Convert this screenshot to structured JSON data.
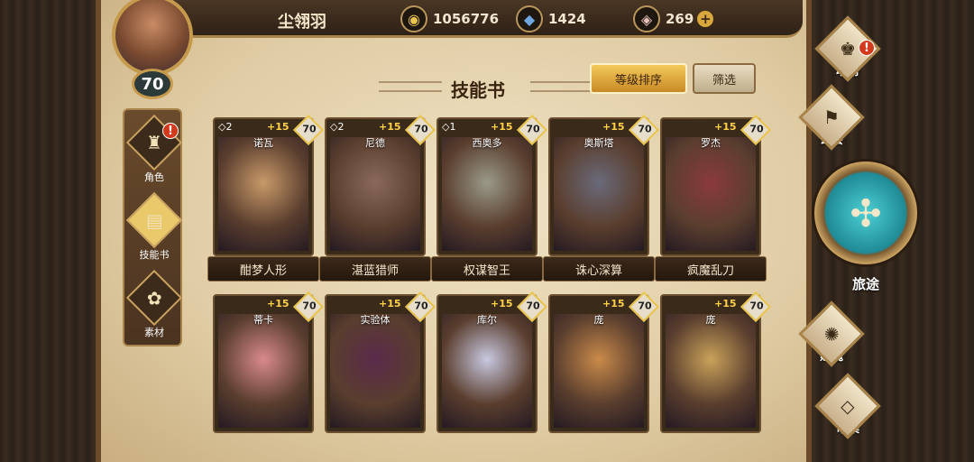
{
  "header": {
    "player_name": "尘翎羽",
    "gold": "1056776",
    "crystal": "1424",
    "gem": "269",
    "plus": "+"
  },
  "player": {
    "level": "70"
  },
  "sidenav": [
    {
      "label": "角色",
      "icon": "helmet-icon",
      "glyph": "♜",
      "alert": "!"
    },
    {
      "label": "技能书",
      "icon": "skillbook-icon",
      "glyph": "▤"
    },
    {
      "label": "素材",
      "icon": "material-icon",
      "glyph": "✿"
    }
  ],
  "section": {
    "title": "技能书",
    "sort_label": "等级排序",
    "filter_label": "筛选"
  },
  "cards": [
    {
      "name": "诺瓦",
      "stars": "◇2",
      "plus": "+15",
      "level": "70",
      "skill": "酣梦人形"
    },
    {
      "name": "尼德",
      "stars": "◇2",
      "plus": "+15",
      "level": "70",
      "skill": "湛蓝猎师"
    },
    {
      "name": "西奥多",
      "stars": "◇1",
      "plus": "+15",
      "level": "70",
      "skill": "权谋智王"
    },
    {
      "name": "奥斯塔",
      "stars": "",
      "plus": "+15",
      "level": "70",
      "skill": "诛心深算"
    },
    {
      "name": "罗杰",
      "stars": "",
      "plus": "+15",
      "level": "70",
      "skill": "疯魔乱刀"
    },
    {
      "name": "蒂卡",
      "stars": "",
      "plus": "+15",
      "level": "70",
      "skill": ""
    },
    {
      "name": "实验体",
      "stars": "",
      "plus": "+15",
      "level": "70",
      "skill": ""
    },
    {
      "name": "库尔",
      "stars": "",
      "plus": "+15",
      "level": "70",
      "skill": ""
    },
    {
      "name": "庞",
      "stars": "",
      "plus": "+15",
      "level": "70",
      "skill": ""
    },
    {
      "name": "庞",
      "stars": "",
      "plus": "+15",
      "level": "70",
      "skill": ""
    }
  ],
  "rightnav": {
    "soulbook": "魂册",
    "guild": "公会",
    "journey": "旅途",
    "soul": "赋魂",
    "market": "市集",
    "alert": "!"
  },
  "colors": {
    "gold_accent": "#e9c44a",
    "alert_red": "#d23a1e",
    "journey_teal": "#1f8a95"
  }
}
